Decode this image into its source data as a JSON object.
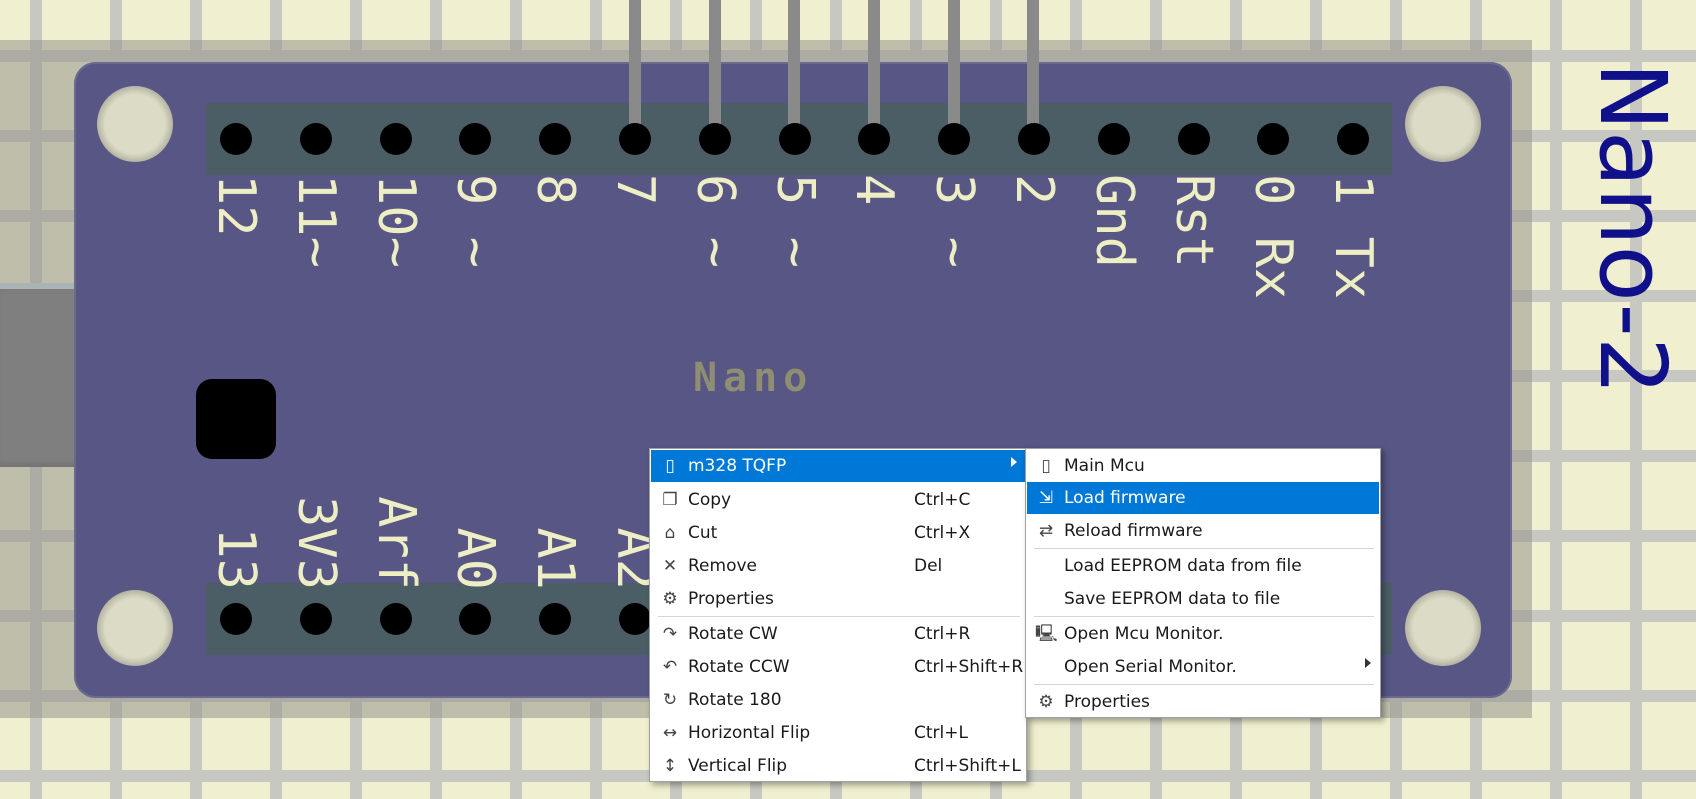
{
  "component": {
    "label": "Nano-2",
    "board_name": "Nano",
    "top_pins": [
      "12",
      "11~",
      "10~",
      "9 ~",
      "8",
      "7",
      "6 ~",
      "5 ~",
      "4",
      "3 ~",
      "2",
      "Gnd",
      "Rst",
      "0 Rx",
      "1 Tx"
    ],
    "bottom_pins": [
      "13",
      "3V3",
      "Arf",
      "A0",
      "A1",
      "A2"
    ]
  },
  "main_menu": {
    "header": {
      "label": "m328 TQFP",
      "icon": "chip-icon"
    },
    "items": [
      {
        "label": "Copy",
        "shortcut": "Ctrl+C",
        "icon": "copy-icon"
      },
      {
        "label": "Cut",
        "shortcut": "Ctrl+X",
        "icon": "cut-icon"
      },
      {
        "label": "Remove",
        "shortcut": "Del",
        "icon": "remove-icon"
      },
      {
        "label": "Properties",
        "shortcut": "",
        "icon": "properties-icon"
      },
      {
        "label": "Rotate CW",
        "shortcut": "Ctrl+R",
        "icon": "rotate-cw-icon"
      },
      {
        "label": "Rotate CCW",
        "shortcut": "Ctrl+Shift+R",
        "icon": "rotate-ccw-icon"
      },
      {
        "label": "Rotate 180",
        "shortcut": "",
        "icon": "rotate-180-icon"
      },
      {
        "label": "Horizontal Flip",
        "shortcut": "Ctrl+L",
        "icon": "horizontal-flip-icon"
      },
      {
        "label": "Vertical Flip",
        "shortcut": "Ctrl+Shift+L",
        "icon": "vertical-flip-icon"
      }
    ]
  },
  "sub_menu": {
    "items": [
      {
        "label": "Main Mcu",
        "icon": "chip-icon"
      },
      {
        "label": "Load firmware",
        "icon": "load-firmware-icon"
      },
      {
        "label": "Reload firmware",
        "icon": "reload-icon"
      },
      {
        "label": "Load EEPROM data from file",
        "icon": ""
      },
      {
        "label": "Save EEPROM data to file",
        "icon": ""
      },
      {
        "label": "Open Mcu Monitor.",
        "icon": "monitor-icon"
      },
      {
        "label": "Open Serial Monitor.",
        "icon": ""
      },
      {
        "label": "Properties",
        "icon": "properties-icon"
      }
    ]
  },
  "colors": {
    "highlight": "#0078d7",
    "board": "#575685",
    "label_text": "#eeeec4",
    "component_label": "#10108a"
  }
}
